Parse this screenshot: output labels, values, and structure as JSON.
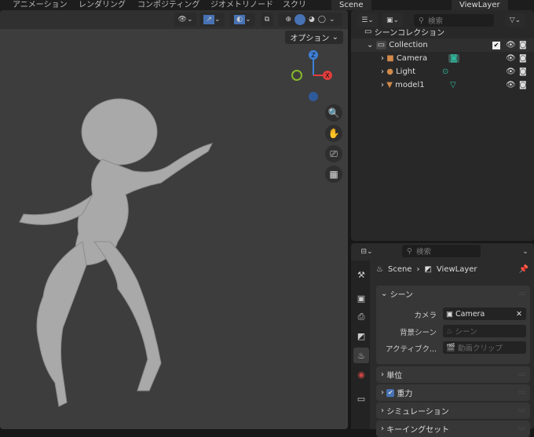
{
  "topbar": {
    "menus": [
      "アニメーション",
      "レンダリング",
      "コンポジティング",
      "ジオメトリノード",
      "スクリ"
    ],
    "scene": "Scene",
    "view_layer": "ViewLayer"
  },
  "viewport": {
    "options_label": "オプション",
    "gizmo": {
      "z": "Z",
      "x": "X"
    }
  },
  "outliner": {
    "search_placeholder": "検索",
    "scene_collection": "シーンコレクション",
    "collection": "Collection",
    "items": [
      {
        "name": "Camera",
        "color": "#d18a4a"
      },
      {
        "name": "Light",
        "color": "#d18a4a"
      },
      {
        "name": "model1",
        "color": "#d18a4a"
      }
    ]
  },
  "properties": {
    "search_placeholder": "検索",
    "breadcrumb": {
      "scene": "Scene",
      "view_layer": "ViewLayer"
    },
    "scene_panel": {
      "title": "シーン",
      "camera_label": "カメラ",
      "camera_value": "Camera",
      "bg_label": "背景シーン",
      "bg_placeholder": "シーン",
      "clip_label": "アクティブク...",
      "clip_placeholder": "動画クリップ"
    },
    "panels": {
      "units": "単位",
      "gravity": "重力",
      "gravity_checked": true,
      "simulation": "シミュレーション",
      "keying": "キーイングセット"
    }
  },
  "colors": {
    "accent": "#4772b3",
    "x_axis": "#e03c3c",
    "y_axis": "#85b82a",
    "z_axis": "#3e7fd6"
  }
}
